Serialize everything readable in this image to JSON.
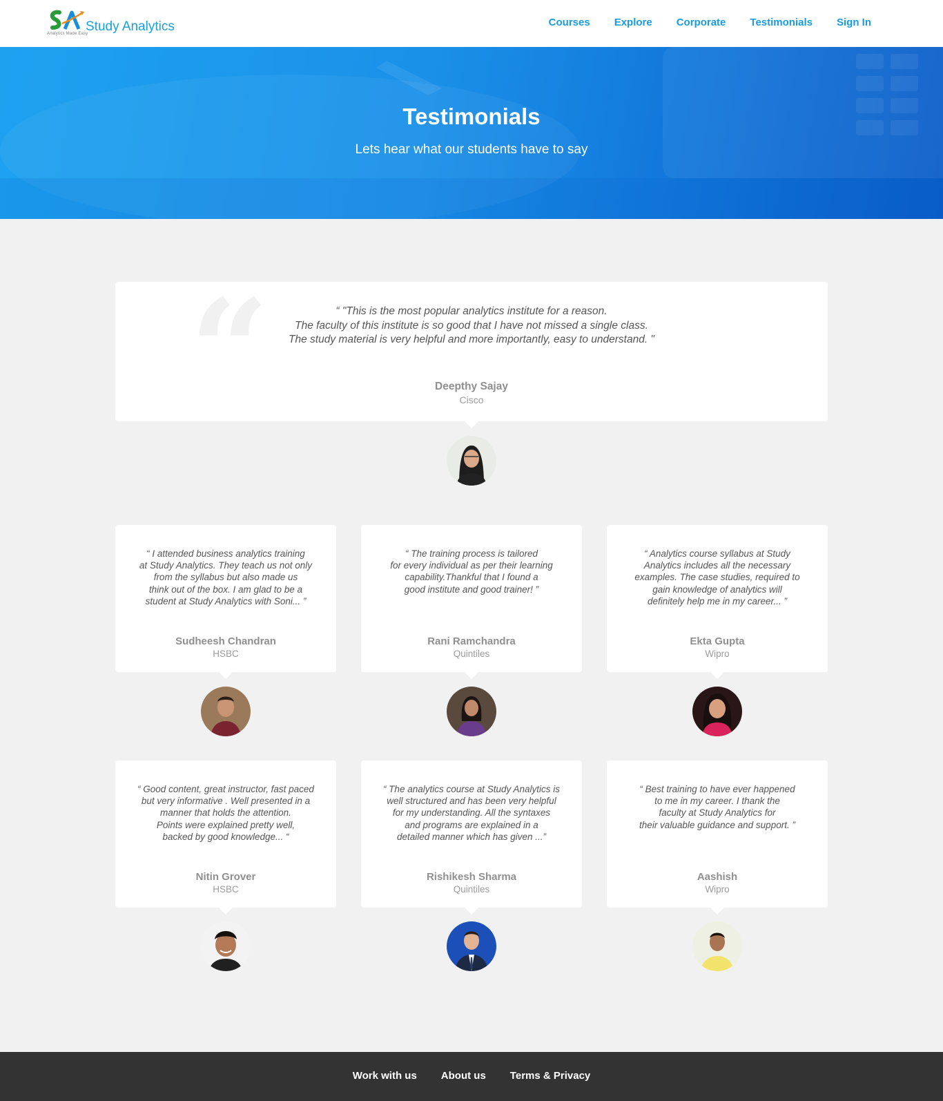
{
  "header": {
    "logo_text": "Study Analytics",
    "logo_tagline": "Analytics Made Easy",
    "nav": [
      "Courses",
      "Explore",
      "Corporate",
      "Testimonials",
      "Sign In"
    ]
  },
  "hero": {
    "title": "Testimonials",
    "subtitle": "Lets hear what our students have to say"
  },
  "featured": {
    "quote_lines": [
      "“ \"This is the most popular analytics institute for a reason.",
      "The faculty of this institute is so good that I have not missed a single class.",
      "The study material is very helpful and more importantly, easy to understand. \""
    ],
    "name": "Deepthy Sajay",
    "company": "Cisco",
    "avatar": "woman-avatar"
  },
  "testimonials": [
    {
      "quote_lines": [
        "“ I attended business analytics training",
        "at Study Analytics. They teach us not only",
        "from the syllabus but also made us",
        "think out of the box. I am glad to be a",
        "student at Study Analytics with Soni... ”"
      ],
      "name": "Sudheesh Chandran",
      "company": "HSBC",
      "avatar": "man-avatar"
    },
    {
      "quote_lines": [
        "“ The training process is tailored",
        "for every individual as per their learning",
        "capability.Thankful that I found a",
        "good institute and good trainer! ”"
      ],
      "name": "Rani Ramchandra",
      "company": "Quintiles",
      "avatar": "woman-avatar"
    },
    {
      "quote_lines": [
        "“ Analytics course syllabus at Study",
        "Analytics includes all the necessary",
        "examples. The case studies, required to",
        "gain knowledge of analytics  will",
        "definitely help me in my career... ”"
      ],
      "name": "Ekta Gupta",
      "company": "Wipro",
      "avatar": "woman-avatar"
    },
    {
      "quote_lines": [
        "“ Good content, great instructor, fast paced",
        "but very informative . Well presented in a",
        "manner that holds the attention.",
        "Points were explained pretty well,",
        "backed by good knowledge... “"
      ],
      "name": "Nitin Grover",
      "company": "HSBC",
      "avatar": "man-avatar"
    },
    {
      "quote_lines": [
        "“ The analytics course at Study Analytics is",
        "well structured and has been very helpful",
        "for my understanding. All the syntaxes",
        "and programs are explained in a",
        "detailed manner which has given ...”"
      ],
      "name": "Rishikesh Sharma",
      "company": "Quintiles",
      "avatar": "man-avatar"
    },
    {
      "quote_lines": [
        "“ Best training to have ever happened",
        "to me in my career. I thank the",
        "faculty at Study Analytics for",
        "their valuable guidance and support. ”"
      ],
      "name": "Aashish",
      "company": "Wipro",
      "avatar": "man-avatar"
    }
  ],
  "footer": {
    "links": [
      "Work with us",
      "About us",
      "Terms & Privacy"
    ]
  }
}
